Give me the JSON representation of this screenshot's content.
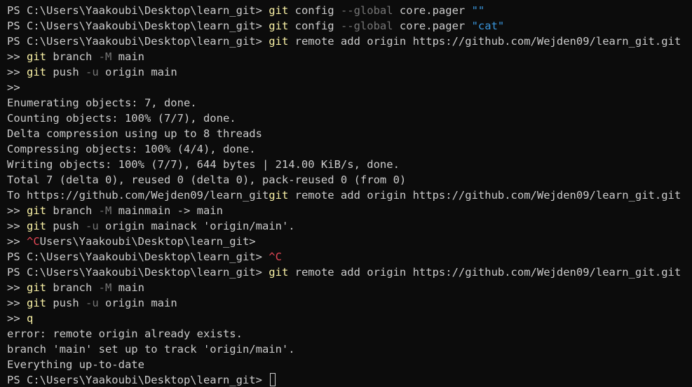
{
  "terminal": {
    "lines": [
      [
        {
          "t": "text",
          "v": "PS C:\\Users\\Yaakoubi\\Desktop\\learn_git> "
        },
        {
          "t": "cmd",
          "v": "git"
        },
        {
          "t": "text",
          "v": " config "
        },
        {
          "t": "param",
          "v": "--global"
        },
        {
          "t": "text",
          "v": " core.pager "
        },
        {
          "t": "string",
          "v": "\"\""
        }
      ],
      [
        {
          "t": "text",
          "v": "PS C:\\Users\\Yaakoubi\\Desktop\\learn_git> "
        },
        {
          "t": "cmd",
          "v": "git"
        },
        {
          "t": "text",
          "v": " config "
        },
        {
          "t": "param",
          "v": "--global"
        },
        {
          "t": "text",
          "v": " core.pager "
        },
        {
          "t": "string",
          "v": "\"cat\""
        }
      ],
      [
        {
          "t": "text",
          "v": "PS C:\\Users\\Yaakoubi\\Desktop\\learn_git> "
        },
        {
          "t": "cmd",
          "v": "git"
        },
        {
          "t": "text",
          "v": " remote add origin https://github.com/Wejden09/learn_git.git"
        }
      ],
      [
        {
          "t": "text",
          "v": ">> "
        },
        {
          "t": "cmd",
          "v": "git"
        },
        {
          "t": "text",
          "v": " branch "
        },
        {
          "t": "param",
          "v": "-M"
        },
        {
          "t": "text",
          "v": " main"
        }
      ],
      [
        {
          "t": "text",
          "v": ">> "
        },
        {
          "t": "cmd",
          "v": "git"
        },
        {
          "t": "text",
          "v": " push "
        },
        {
          "t": "param",
          "v": "-u"
        },
        {
          "t": "text",
          "v": " origin main"
        }
      ],
      [
        {
          "t": "text",
          "v": ">>"
        }
      ],
      [
        {
          "t": "text",
          "v": "Enumerating objects: 7, done."
        }
      ],
      [
        {
          "t": "text",
          "v": "Counting objects: 100% (7/7), done."
        }
      ],
      [
        {
          "t": "text",
          "v": "Delta compression using up to 8 threads"
        }
      ],
      [
        {
          "t": "text",
          "v": "Compressing objects: 100% (4/4), done."
        }
      ],
      [
        {
          "t": "text",
          "v": "Writing objects: 100% (7/7), 644 bytes | 214.00 KiB/s, done."
        }
      ],
      [
        {
          "t": "text",
          "v": "Total 7 (delta 0), reused 0 (delta 0), pack-reused 0 (from 0)"
        }
      ],
      [
        {
          "t": "text",
          "v": "To https://github.com/Wejden09/learn_git"
        },
        {
          "t": "cmd",
          "v": "git"
        },
        {
          "t": "text",
          "v": " remote add origin https://github.com/Wejden09/learn_git.git"
        }
      ],
      [
        {
          "t": "text",
          "v": ">> "
        },
        {
          "t": "cmd",
          "v": "git"
        },
        {
          "t": "text",
          "v": " branch "
        },
        {
          "t": "param",
          "v": "-M"
        },
        {
          "t": "text",
          "v": " mainmain -> main"
        }
      ],
      [
        {
          "t": "text",
          "v": ">> "
        },
        {
          "t": "cmd",
          "v": "git"
        },
        {
          "t": "text",
          "v": " push "
        },
        {
          "t": "param",
          "v": "-u"
        },
        {
          "t": "text",
          "v": " origin mainack 'origin/main'."
        }
      ],
      [
        {
          "t": "text",
          "v": ">> "
        },
        {
          "t": "ctrl",
          "v": "^C"
        },
        {
          "t": "text",
          "v": "Users\\Yaakoubi\\Desktop\\learn_git>"
        }
      ],
      [
        {
          "t": "text",
          "v": "PS C:\\Users\\Yaakoubi\\Desktop\\learn_git> "
        },
        {
          "t": "ctrl",
          "v": "^C"
        }
      ],
      [
        {
          "t": "text",
          "v": "PS C:\\Users\\Yaakoubi\\Desktop\\learn_git> "
        },
        {
          "t": "cmd",
          "v": "git"
        },
        {
          "t": "text",
          "v": " remote add origin https://github.com/Wejden09/learn_git.git"
        }
      ],
      [
        {
          "t": "text",
          "v": ">> "
        },
        {
          "t": "cmd",
          "v": "git"
        },
        {
          "t": "text",
          "v": " branch "
        },
        {
          "t": "param",
          "v": "-M"
        },
        {
          "t": "text",
          "v": " main"
        }
      ],
      [
        {
          "t": "text",
          "v": ">> "
        },
        {
          "t": "cmd",
          "v": "git"
        },
        {
          "t": "text",
          "v": " push "
        },
        {
          "t": "param",
          "v": "-u"
        },
        {
          "t": "text",
          "v": " origin main"
        }
      ],
      [
        {
          "t": "text",
          "v": ">> "
        },
        {
          "t": "cmd",
          "v": "q"
        }
      ],
      [
        {
          "t": "text",
          "v": "error: remote origin already exists."
        }
      ],
      [
        {
          "t": "text",
          "v": "branch 'main' set up to track 'origin/main'."
        }
      ],
      [
        {
          "t": "text",
          "v": "Everything up-to-date"
        }
      ],
      [
        {
          "t": "text",
          "v": "PS C:\\Users\\Yaakoubi\\Desktop\\learn_git> "
        }
      ]
    ],
    "cursor_on_last_line": true
  },
  "colors": {
    "background": "#0c0c0c",
    "text": "#cccccc",
    "command": "#f9f1a5",
    "parameter": "#767676",
    "string": "#3a96dd",
    "control": "#e74856"
  }
}
